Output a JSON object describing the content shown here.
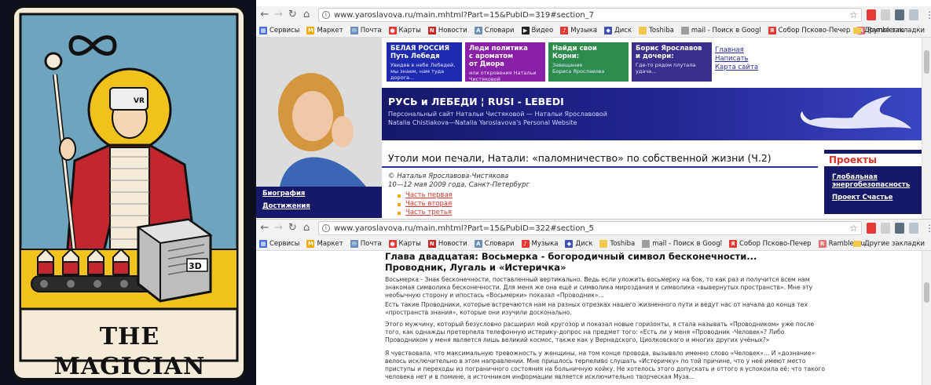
{
  "tarot": {
    "title": "THE MAGICIAN",
    "box_label": "3D",
    "visor_label": "VR"
  },
  "browser1": {
    "url": "www.yaroslavova.ru/main.mhtml?Part=15&PubID=319#section_7",
    "bookmarks": [
      "Сервисы",
      "Маркет",
      "Почта",
      "Карты",
      "Новости",
      "Словари",
      "Видео",
      "Музыка",
      "Диск",
      "Toshiba",
      "mail - Поиск в Googl",
      "Собор Псково-Печер",
      "Rambler.ru"
    ],
    "other_bookmarks": "Другие закладки",
    "site": {
      "blocks": [
        {
          "title": "БЕЛАЯ РОССИЯ\nПуть Лебедя",
          "subtitle": "Увидев в небе Лебедей,\nмы знаем, нам туда\nдорога...",
          "color": "#1e2bb0"
        },
        {
          "title": "Леди политика\nс ароматом\nот Диора",
          "subtitle": "или откровения Натальи\nЧистяковой",
          "color": "#8a1fa8"
        },
        {
          "title": "Найди свои Корни:",
          "subtitle": "Завещание\nБориса Ярославова",
          "color": "#2c8c4e"
        },
        {
          "title": "Борис Ярославов\nи дочери:",
          "subtitle": "Где-то рядом плутала\nудача...",
          "color": "#3a2f8c"
        }
      ],
      "top_links": [
        "Главная",
        "Написать",
        "Карта сайта"
      ],
      "banner": {
        "title": "РУСЬ и ЛЕБЕДИ ¦ RUSI - LEBEDI",
        "subtitle1": "Персональный сайт Натальи Чистяковой — Натальи Ярославовой",
        "subtitle2": "Natalia Chistiakova—Natalia Yaroslavova's Personal Website"
      },
      "page_title": "Утоли мои печали, Натали: «паломничество» по собственной жизни (Ч.2)",
      "author": "© Наталья Ярославова-Чистякова",
      "dateline": "10—12 мая 2009 года, Санкт-Петербург",
      "parts": [
        "Часть первая",
        "Часть вторая",
        "Часть третья"
      ],
      "left_nav": [
        "Биография",
        "Достижения"
      ],
      "projects": {
        "title": "Проекты",
        "links": [
          "Глобальная энергобезопасность",
          "Проект Счастье"
        ]
      }
    }
  },
  "browser2": {
    "url": "www.yaroslavova.ru/main.mhtml?Part=15&PubID=322#section_5",
    "bookmarks": [
      "Сервисы",
      "Маркет",
      "Почта",
      "Карты",
      "Новости",
      "Словари",
      "Музыка",
      "Диск",
      "Toshiba",
      "mail - Поиск в Googl",
      "Собор Псково-Печер",
      "Rambler.ru"
    ],
    "other_bookmarks": "Другие закладки",
    "chapter_title": "Глава двадцатая: Восьмерка - богородичный символ бесконечности... Проводник, Лугаль и «Истеричка»",
    "paragraphs": [
      "Восьмерка - Знак бесконечности, поставленный вертикально. Ведь если уложить восьмерку на бок, то как раз и получится всем нам знакомая символика бесконечности. Для меня же она ещё и символика мироздания и символика «вывернутых пространств». Мне эту необычную сторону и ипостась «Восьмерки» показал «Проводник»...",
      "Есть такие Проводники, которые встречаются нам на разных отрезках нашего жизненного пути и ведут нас от начала до конца тех «пространств знания», которые они изучили досконально.",
      "Этого мужчину, который безусловно расширил мой кругозор и показал новые горизонты, я стала называть «Проводником» уже после того, как однажды претерпела телефонную истерику-допрос на предмет того: «Есть ли у меня «Проводник -Человек»? Либо Проводником у меня является лишь великий космос, также как у Вернадского, Циолковского и многих других учёных?»",
      "Я чувствовала, что максимальную тревожность у женщины, на том конце провода, вызывало именно слово «Человек»... И «дознание» велось исключительно в этом направлении. Мне пришлось терпеливо слушать «Истеричку» по той причине, что у неё имеют место приступы и переходы из пограничного состояния на больничную койку. Не хотелось этого допускать и оттого я успокоила её: что такого человека нет и в помине, а источником информации является исключительно творческая Муза..."
    ]
  }
}
